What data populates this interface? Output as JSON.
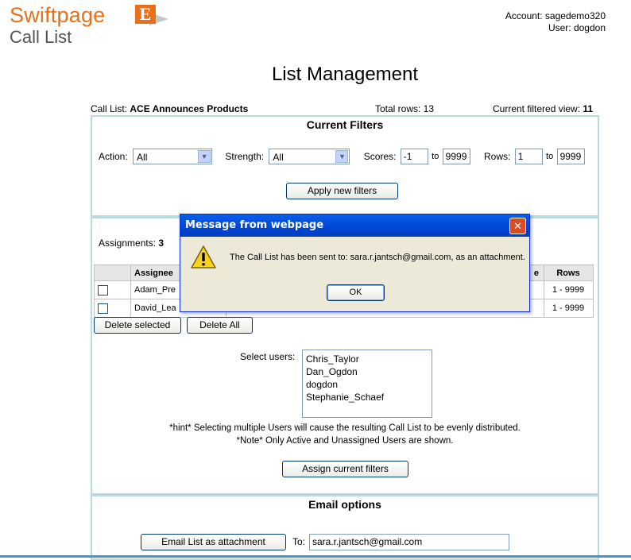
{
  "header": {
    "brand": "Swiftpage",
    "brand_mark": "E",
    "subtitle": "Call List",
    "account": "Account: sagedemo320",
    "user": "User: dogdon"
  },
  "page_title": "List Management",
  "info": {
    "call_list_label": "Call List:",
    "call_list_name": "ACE Announces Products",
    "total_rows": "Total rows: 13",
    "filtered_label": "Current filtered view:",
    "filtered_value": "11"
  },
  "filters": {
    "title": "Current Filters",
    "action_label": "Action:",
    "action_value": "All",
    "strength_label": "Strength:",
    "strength_value": "All",
    "scores_label": "Scores:",
    "scores_from": "-1",
    "to_label": "to",
    "scores_to": "9999",
    "rows_label": "Rows:",
    "rows_from": "1",
    "rows_to": "9999",
    "apply_button": "Apply new filters"
  },
  "assignments": {
    "label": "Assignments:",
    "count": "3",
    "columns": [
      "",
      "Assignee",
      "e",
      "Rows"
    ],
    "rows": [
      {
        "assignee": "Adam_Pre",
        "rows": "1 - 9999"
      },
      {
        "assignee": "David_Lea",
        "rows": "1 - 9999"
      }
    ],
    "delete_selected": "Delete selected",
    "delete_all": "Delete All",
    "select_users_label": "Select users:",
    "users": [
      "Chris_Taylor",
      "Dan_Ogdon",
      "dogdon",
      "Stephanie_Schaef"
    ],
    "hint": "*hint* Selecting multiple Users will cause the resulting Call List to be evenly distributed.",
    "note": "*Note* Only Active and Unassigned Users are shown.",
    "assign_button": "Assign current filters"
  },
  "email": {
    "title": "Email options",
    "email_button": "Email List as attachment",
    "to_label": "To:",
    "to_value": "sara.r.jantsch@gmail.com"
  },
  "dialog": {
    "title": "Message from webpage",
    "message": "The Call List has been sent to: sara.r.jantsch@gmail.com, as an attachment.",
    "ok_label": "OK"
  },
  "colors": {
    "brand_orange": "#e8701a",
    "panel_border": "#b8dcdc",
    "dialog_title": "#0046d5"
  }
}
